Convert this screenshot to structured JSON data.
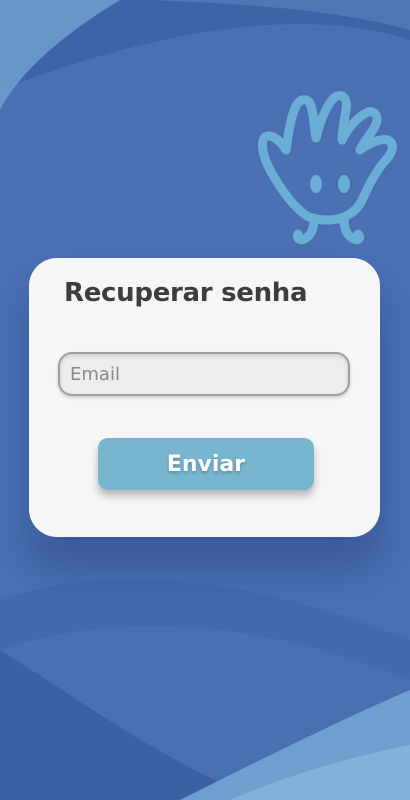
{
  "colors": {
    "background": "#4a6fb3",
    "background_dark": "#3d5fa3",
    "wave_light": "#6f9fcf",
    "card": "#f6f6f6",
    "title_text": "#3d3d3d",
    "button": "#78b6cf",
    "mascot": "#6aaed6"
  },
  "mascot": {
    "icon": "hand-mascot-icon"
  },
  "recover_form": {
    "title": "Recuperar senha",
    "email_placeholder": "Email",
    "email_value": "",
    "submit_label": "Enviar"
  }
}
